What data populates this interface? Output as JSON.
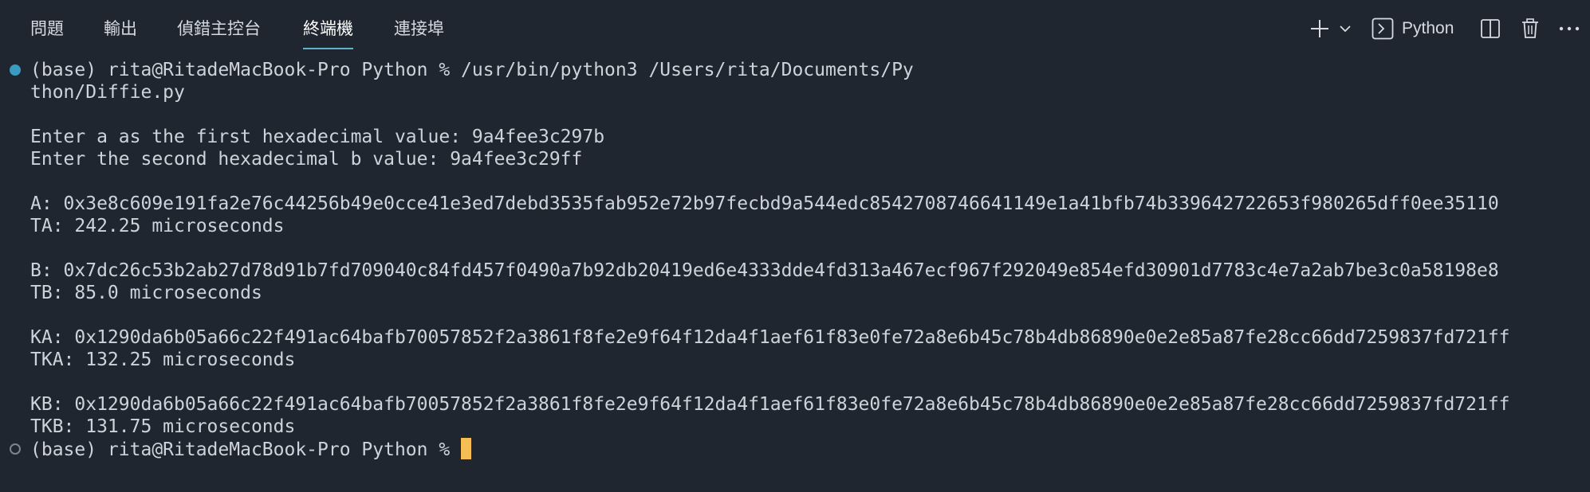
{
  "tabs": [
    {
      "label": "問題",
      "active": false
    },
    {
      "label": "輸出",
      "active": false
    },
    {
      "label": "偵錯主控台",
      "active": false
    },
    {
      "label": "終端機",
      "active": true
    },
    {
      "label": "連接埠",
      "active": false
    }
  ],
  "toolbar": {
    "new_terminal_icon": "plus-icon",
    "dropdown_icon": "chevron-down-icon",
    "terminal_icon": "terminal-icon",
    "profile_label": "Python",
    "split_icon": "split-editor-icon",
    "trash_icon": "trash-icon",
    "more_icon": "ellipsis-icon"
  },
  "terminal": {
    "lines": [
      "(base) rita@RitadeMacBook-Pro Python % /usr/bin/python3 /Users/rita/Documents/Py",
      "thon/Diffie.py",
      "",
      "Enter a as the first hexadecimal value: 9a4fee3c297b",
      "Enter the second hexadecimal b value: 9a4fee3c29ff",
      "",
      "A: 0x3e8c609e191fa2e76c44256b49e0cce41e3ed7debd3535fab952e72b97fecbd9a544edc8542708746641149e1a41bfb74b339642722653f980265dff0ee35110",
      "TA: 242.25 microseconds",
      "",
      "B: 0x7dc26c53b2ab27d78d91b7fd709040c84fd457f0490a7b92db20419ed6e4333dde4fd313a467ecf967f292049e854efd30901d7783c4e7a2ab7be3c0a58198e8",
      "TB: 85.0 microseconds",
      "",
      "KA: 0x1290da6b05a66c22f491ac64bafb70057852f2a3861f8fe2e9f64f12da4f1aef61f83e0fe72a8e6b45c78b4db86890e0e2e85a87fe28cc66dd7259837fd721ff",
      "TKA: 132.25 microseconds",
      "",
      "KB: 0x1290da6b05a66c22f491ac64bafb70057852f2a3861f8fe2e9f64f12da4f1aef61f83e0fe72a8e6b45c78b4db86890e0e2e85a87fe28cc66dd7259837fd721ff",
      "TKB: 131.75 microseconds"
    ],
    "prompt": "(base) rita@RitadeMacBook-Pro Python % ",
    "colors": {
      "background": "#1f262f",
      "text": "#cdd3da",
      "success_decoration": "#3a9bc1",
      "cursor": "#f5bd54",
      "active_tab_underline": "#5fb4c9"
    }
  }
}
